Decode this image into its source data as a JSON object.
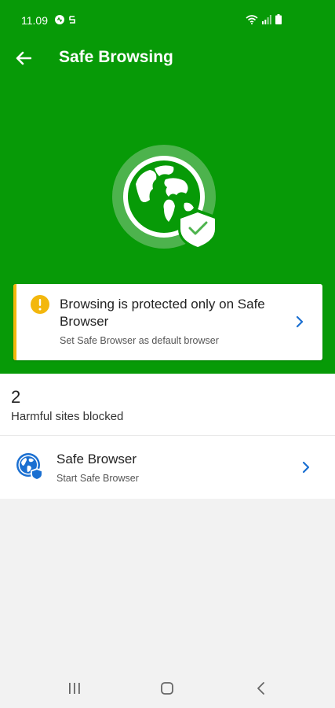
{
  "status_bar": {
    "time": "11.09",
    "left_icons": [
      "notification-dot-icon",
      "app-notification-icon"
    ],
    "right_icons": [
      "wifi-icon",
      "signal-icon",
      "battery-icon"
    ]
  },
  "app_bar": {
    "title": "Safe Browsing",
    "back_icon": "back-arrow-icon"
  },
  "hero": {
    "icon": "globe-shield-check-icon"
  },
  "warning_card": {
    "icon": "warning-icon",
    "title": "Browsing is protected only on Safe Browser",
    "subtitle": "Set Safe Browser as default browser",
    "chevron_icon": "chevron-right-icon"
  },
  "stats": {
    "count": "2",
    "label": "Harmful sites blocked"
  },
  "safe_browser_row": {
    "icon": "safe-browser-globe-icon",
    "title": "Safe Browser",
    "subtitle": "Start Safe Browser",
    "chevron_icon": "chevron-right-icon"
  },
  "nav_bar": {
    "buttons": [
      "recents-icon",
      "home-icon",
      "back-icon"
    ]
  },
  "colors": {
    "header_green": "#079a07",
    "warning_amber": "#f3b70d",
    "link_blue": "#1a6fd1",
    "background": "#f2f2f2"
  }
}
